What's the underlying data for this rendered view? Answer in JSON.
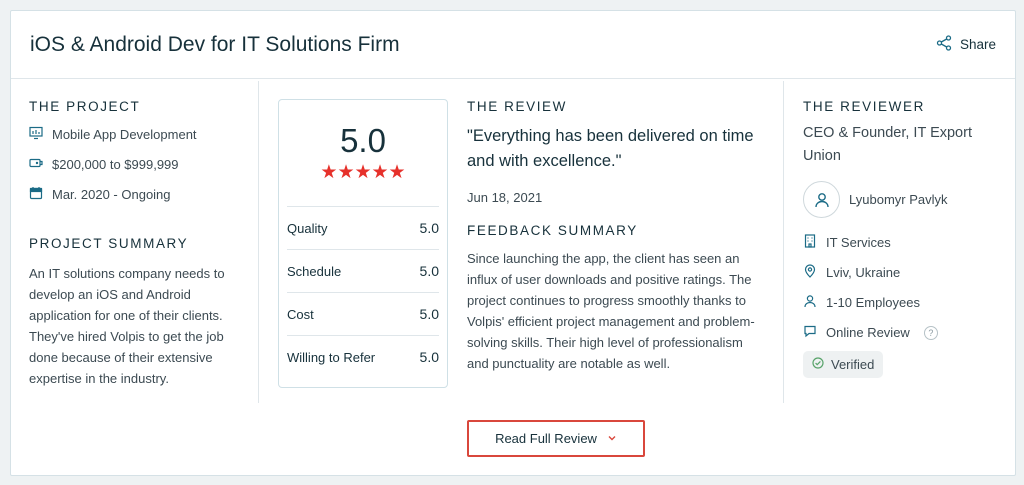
{
  "header": {
    "title": "iOS & Android Dev for IT Solutions Firm",
    "share_label": "Share"
  },
  "project": {
    "heading": "THE PROJECT",
    "service": "Mobile App Development",
    "budget": "$200,000 to $999,999",
    "dates": "Mar. 2020 - Ongoing",
    "summary_heading": "PROJECT SUMMARY",
    "summary": "An IT solutions company needs to develop an iOS and Android application for one of their clients. They've hired Volpis to get the job done because of their extensive expertise in the industry."
  },
  "rating": {
    "overall": "5.0",
    "stars": "★★★★★",
    "rows": [
      {
        "label": "Quality",
        "value": "5.0"
      },
      {
        "label": "Schedule",
        "value": "5.0"
      },
      {
        "label": "Cost",
        "value": "5.0"
      },
      {
        "label": "Willing to Refer",
        "value": "5.0"
      }
    ]
  },
  "review": {
    "heading": "THE REVIEW",
    "quote": "\"Everything has been delivered on time and with excellence.\"",
    "date": "Jun 18, 2021",
    "feedback_heading": "FEEDBACK SUMMARY",
    "feedback": "Since launching the app, the client has seen an influx of user downloads and positive ratings. The project continues to progress smoothly thanks to Volpis' efficient project management and problem-solving skills. Their high level of professionalism and punctuality are notable as well."
  },
  "reviewer": {
    "heading": "THE REVIEWER",
    "role": "CEO & Founder, IT Export Union",
    "name": "Lyubomyr Pavlyk",
    "industry": "IT Services",
    "location": "Lviv, Ukraine",
    "size": "1-10 Employees",
    "review_type": "Online Review",
    "help_glyph": "?",
    "verified": "Verified"
  },
  "actions": {
    "read_full_review": "Read Full Review"
  },
  "colors": {
    "accent_red": "#e6312b",
    "button_border": "#d9473c",
    "text_dark": "#17313b"
  }
}
